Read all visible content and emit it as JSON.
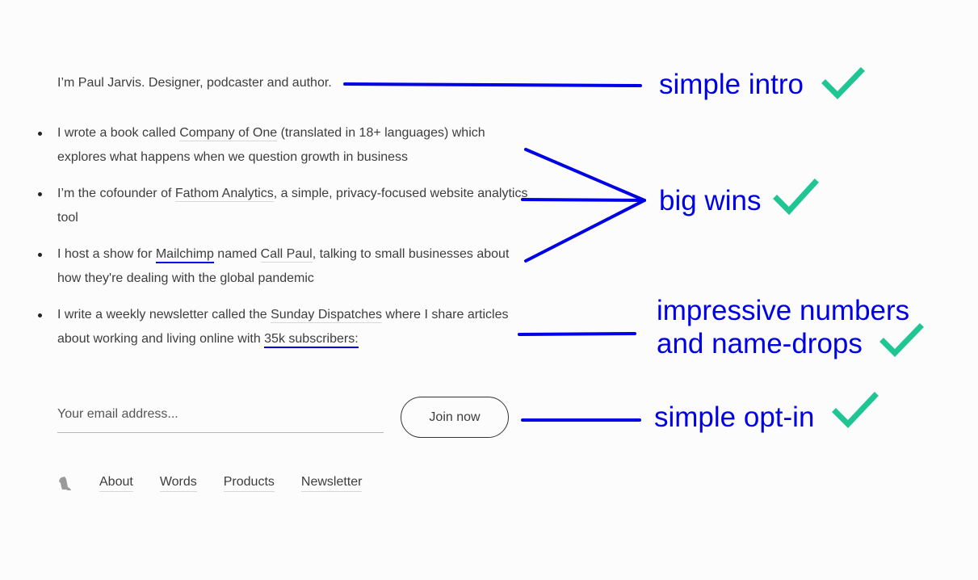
{
  "intro": "I’m Paul Jarvis. Designer, podcaster and author.",
  "wins": [
    {
      "pre": "I wrote a book called ",
      "link": "Company of One",
      "post": " (translated in 18+ languages) which explores what happens when we question growth in business"
    },
    {
      "pre": "I’m the cofounder of ",
      "link": "Fathom Analytics",
      "post": ", a simple, privacy-focused website analytics tool"
    },
    {
      "pre": "I host a show for ",
      "link": "Mailchimp",
      "mid": " named ",
      "link2": "Call Paul",
      "post": ", talking to small businesses about how they're dealing with the global pandemic"
    },
    {
      "pre": "I write a weekly newsletter called the ",
      "link": "Sunday Dispatches",
      "mid": " where I share articles about working and living online with ",
      "link2": "35k subscribers:"
    }
  ],
  "signup": {
    "email_placeholder": "Your email address...",
    "email_value": "",
    "button_label": "Join now"
  },
  "footer": {
    "logo_icon": "mouse-logo-icon",
    "links": [
      "About",
      "Words",
      "Products",
      "Newsletter"
    ]
  },
  "annotations": {
    "intro": "simple intro",
    "wins": "big wins",
    "numbers_line1": "impressive numbers",
    "numbers_line2": "and name-drops",
    "optin": "simple opt-in",
    "check_icon": "checkmark-icon"
  },
  "colors": {
    "annotation_blue": "#0000e6",
    "check_green": "#1fc694",
    "text": "#3d3d3d",
    "background": "#fcfcfc"
  }
}
